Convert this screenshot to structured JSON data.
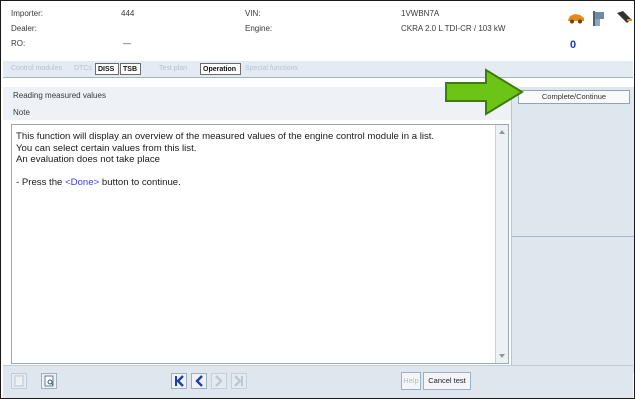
{
  "header": {
    "importer_label": "Importer:",
    "importer_value": "444",
    "dealer_label": "Dealer:",
    "ro_label": "RO:",
    "ro_value": "—",
    "vin_label": "VIN:",
    "vin_value": "1VWBN7A",
    "engine_label": "Engine:",
    "engine_value": "CKRA 2.0 L TDI-CR / 103 kW",
    "counter": "0",
    "icons": [
      "car-icon",
      "flag-icon",
      "plug-icon"
    ]
  },
  "tabs": [
    {
      "label": "Control modules",
      "state": "disabled"
    },
    {
      "label": "DTCs",
      "state": "disabled"
    },
    {
      "label": "DISS",
      "state": "active"
    },
    {
      "label": "TSB",
      "state": "active"
    },
    {
      "label": "Test plan",
      "state": "disabled"
    },
    {
      "label": "Operation",
      "state": "active"
    },
    {
      "label": "Special functions",
      "state": "disabled"
    }
  ],
  "panel": {
    "title": "Reading measured values",
    "subtitle": "Note",
    "line1": "This function will display an overview of the measured values of the engine control module in a list.",
    "line2": "You can select certain values from this list.",
    "line3": "An evaluation does not take place",
    "press_prefix": "- Press the ",
    "press_done": "<Done>",
    "press_suffix": " button to continue."
  },
  "right": {
    "continue_label": "Complete/Continue"
  },
  "footer": {
    "help_label": "Help",
    "cancel_label": "Cancel test"
  },
  "colors": {
    "accent_green": "#6cc417",
    "done_link": "#3a3cff",
    "panel_bg": "#dfe6ee"
  }
}
